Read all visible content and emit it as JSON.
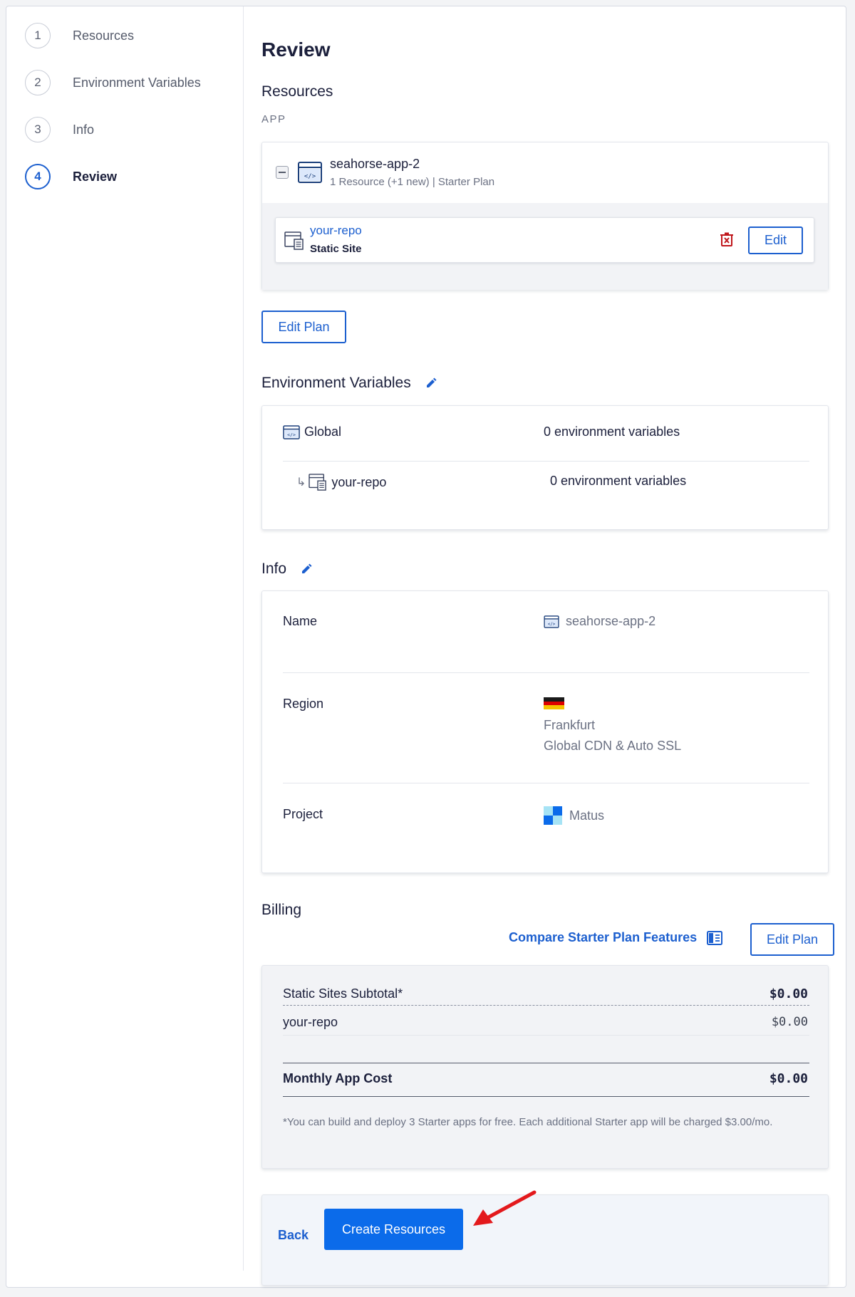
{
  "sidebar": {
    "steps": [
      {
        "num": "1",
        "label": "Resources"
      },
      {
        "num": "2",
        "label": "Environment Variables"
      },
      {
        "num": "3",
        "label": "Info"
      },
      {
        "num": "4",
        "label": "Review"
      }
    ],
    "active_step": "4"
  },
  "review": {
    "title": "Review",
    "resources": {
      "heading": "Resources",
      "caption": "APP",
      "app_name": "seahorse-app-2",
      "app_sub": "1 Resource (+1 new) | Starter Plan",
      "component_name": "your-repo",
      "component_type": "Static Site",
      "edit_label": "Edit",
      "edit_plan_label": "Edit Plan"
    },
    "env": {
      "heading": "Environment Variables",
      "rows": [
        {
          "name": "Global",
          "value": "0 environment variables"
        },
        {
          "prefix": "↳",
          "name": "your-repo",
          "value": "0 environment variables"
        }
      ]
    },
    "info": {
      "heading": "Info",
      "name_label": "Name",
      "name_value": "seahorse-app-2",
      "region_label": "Region",
      "region_city": "Frankfurt",
      "region_extra": "Global CDN & Auto SSL",
      "project_label": "Project",
      "project_value": "Matus"
    },
    "billing": {
      "heading": "Billing",
      "compare_link": "Compare Starter Plan Features",
      "edit_plan_label": "Edit Plan",
      "subtotal_label": "Static Sites Subtotal*",
      "subtotal_value": "$0.00",
      "line_label": "your-repo",
      "line_value": "$0.00",
      "monthly_label": "Monthly App Cost",
      "monthly_value": "$0.00",
      "note": "*You can build and deploy 3 Starter apps for free. Each additional Starter app will be charged $3.00/mo."
    },
    "footer": {
      "back_label": "Back",
      "create_label": "Create Resources"
    }
  },
  "colors": {
    "accent": "#1c5fcf",
    "primary_button": "#0b6bea",
    "danger": "#c0171c",
    "annotation_arrow": "#e3191c"
  }
}
